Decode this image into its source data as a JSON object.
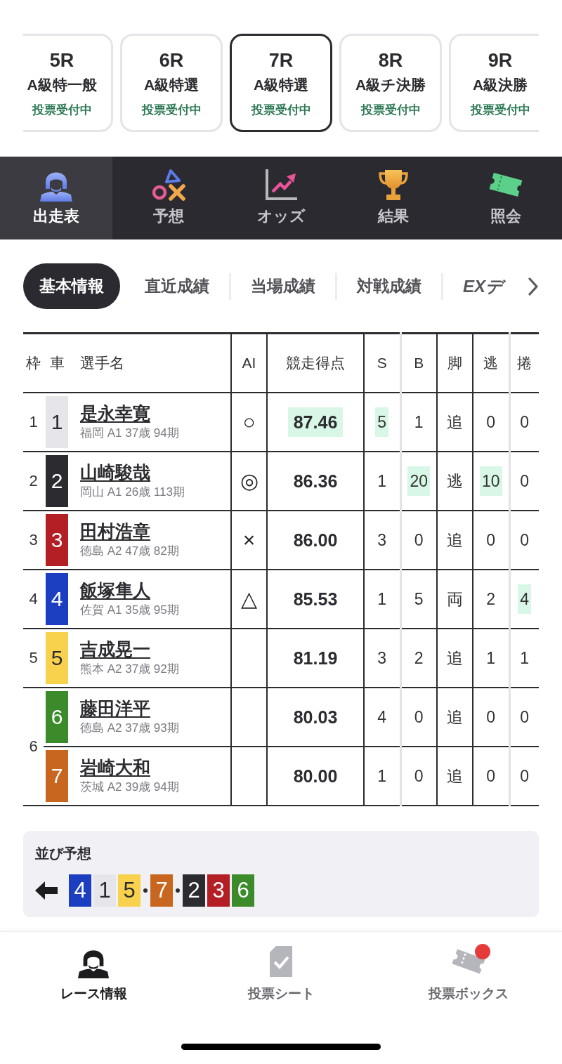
{
  "races": [
    {
      "number": "5R",
      "grade": "A級特一般",
      "status": "投票受付中",
      "selected": false
    },
    {
      "number": "6R",
      "grade": "A級特選",
      "status": "投票受付中",
      "selected": false
    },
    {
      "number": "7R",
      "grade": "A級特選",
      "status": "投票受付中",
      "selected": true
    },
    {
      "number": "8R",
      "grade": "A級チ決勝",
      "status": "投票受付中",
      "selected": false
    },
    {
      "number": "9R",
      "grade": "A級決勝",
      "status": "投票受付中",
      "selected": false
    }
  ],
  "nav": {
    "items": [
      {
        "label": "出走表",
        "selected": true
      },
      {
        "label": "予想",
        "selected": false
      },
      {
        "label": "オッズ",
        "selected": false
      },
      {
        "label": "結果",
        "selected": false
      },
      {
        "label": "照会",
        "selected": false
      }
    ]
  },
  "sub_tabs": {
    "items": [
      {
        "label": "基本情報",
        "kind": "label",
        "selected": true
      },
      {
        "label": "直近成績",
        "kind": "label",
        "selected": false
      },
      {
        "label": "当場成績",
        "kind": "label",
        "selected": false
      },
      {
        "label": "対戦成績",
        "kind": "label",
        "selected": false
      },
      {
        "label": "EXデ",
        "kind": "logo",
        "selected": false
      }
    ]
  },
  "table": {
    "columns": [
      "枠",
      "車",
      "選手名",
      "AI",
      "競走得点",
      "S",
      "B",
      "脚",
      "逃",
      "捲"
    ],
    "frames": [
      {
        "frame": "1",
        "riders": [
          {
            "car": "1",
            "color": "#e5e5ea",
            "name": "是永幸寛",
            "profile": "福岡 A1 37歳 94期",
            "ai": "○",
            "stats": [
              {
                "text": "87.46",
                "highlighted": true
              },
              {
                "text": "5",
                "highlighted": true
              },
              {
                "text": "1",
                "highlighted": false
              },
              {
                "text": "追",
                "highlighted": false
              },
              {
                "text": "0",
                "highlighted": false
              },
              {
                "text": "0",
                "highlighted": false
              }
            ]
          }
        ]
      },
      {
        "frame": "2",
        "riders": [
          {
            "car": "2",
            "color": "#2c2c30",
            "name": "山崎駿哉",
            "profile": "岡山 A1 26歳 113期",
            "ai": "◎",
            "stats": [
              {
                "text": "86.36",
                "highlighted": false
              },
              {
                "text": "1",
                "highlighted": false
              },
              {
                "text": "20",
                "highlighted": true
              },
              {
                "text": "逃",
                "highlighted": false
              },
              {
                "text": "10",
                "highlighted": true
              },
              {
                "text": "0",
                "highlighted": false
              }
            ]
          }
        ]
      },
      {
        "frame": "3",
        "riders": [
          {
            "car": "3",
            "color": "#b31f24",
            "name": "田村浩章",
            "profile": "徳島 A2 47歳 82期",
            "ai": "×",
            "stats": [
              {
                "text": "86.00",
                "highlighted": false
              },
              {
                "text": "3",
                "highlighted": false
              },
              {
                "text": "0",
                "highlighted": false
              },
              {
                "text": "追",
                "highlighted": false
              },
              {
                "text": "0",
                "highlighted": false
              },
              {
                "text": "0",
                "highlighted": false
              }
            ]
          }
        ]
      },
      {
        "frame": "4",
        "riders": [
          {
            "car": "4",
            "color": "#1b3fc0",
            "name": "飯塚隼人",
            "profile": "佐賀 A1 35歳 95期",
            "ai": "△",
            "stats": [
              {
                "text": "85.53",
                "highlighted": false
              },
              {
                "text": "1",
                "highlighted": false
              },
              {
                "text": "5",
                "highlighted": false
              },
              {
                "text": "両",
                "highlighted": false
              },
              {
                "text": "2",
                "highlighted": false
              },
              {
                "text": "4",
                "highlighted": true
              }
            ]
          }
        ]
      },
      {
        "frame": "5",
        "riders": [
          {
            "car": "5",
            "color": "#f8d24c",
            "name": "吉成晃一",
            "profile": "熊本 A2 37歳 92期",
            "stats": [
              {
                "text": "81.19",
                "highlighted": false
              },
              {
                "text": "3",
                "highlighted": false
              },
              {
                "text": "2",
                "highlighted": false
              },
              {
                "text": "追",
                "highlighted": false
              },
              {
                "text": "1",
                "highlighted": false
              },
              {
                "text": "1",
                "highlighted": false
              }
            ]
          }
        ]
      },
      {
        "frame": "6",
        "riders": [
          {
            "car": "6",
            "color": "#3b8b2a",
            "name": "藤田洋平",
            "profile": "徳島 A2 37歳 93期",
            "stats": [
              {
                "text": "80.03",
                "highlighted": false
              },
              {
                "text": "4",
                "highlighted": false
              },
              {
                "text": "0",
                "highlighted": false
              },
              {
                "text": "追",
                "highlighted": false
              },
              {
                "text": "0",
                "highlighted": false
              },
              {
                "text": "0",
                "highlighted": false
              }
            ]
          },
          {
            "car": "7",
            "color": "#c8661f",
            "name": "岩崎大和",
            "profile": "茨城 A2 39歳 94期",
            "stats": [
              {
                "text": "80.00",
                "highlighted": false
              },
              {
                "text": "1",
                "highlighted": false
              },
              {
                "text": "0",
                "highlighted": false
              },
              {
                "text": "追",
                "highlighted": false
              },
              {
                "text": "0",
                "highlighted": false
              },
              {
                "text": "0",
                "highlighted": false
              }
            ]
          }
        ]
      }
    ]
  },
  "line_prediction": {
    "title": "並び予想",
    "groups": [
      {
        "cars": [
          {
            "number": "4",
            "color": "#1b3fc0"
          },
          {
            "number": "1",
            "color": "#e5e5ea"
          },
          {
            "number": "5",
            "color": "#f8d24c"
          }
        ]
      },
      {
        "cars": [
          {
            "number": "7",
            "color": "#c8661f"
          }
        ]
      },
      {
        "cars": [
          {
            "number": "2",
            "color": "#2c2c30"
          },
          {
            "number": "3",
            "color": "#b31f24"
          },
          {
            "number": "6",
            "color": "#3b8b2a"
          }
        ]
      }
    ]
  },
  "bottom_tabs": {
    "items": [
      {
        "label": "レース情報",
        "selected": true,
        "badge": false
      },
      {
        "label": "投票シート",
        "selected": false,
        "badge": false
      },
      {
        "label": "投票ボックス",
        "selected": false,
        "badge": true
      }
    ]
  }
}
